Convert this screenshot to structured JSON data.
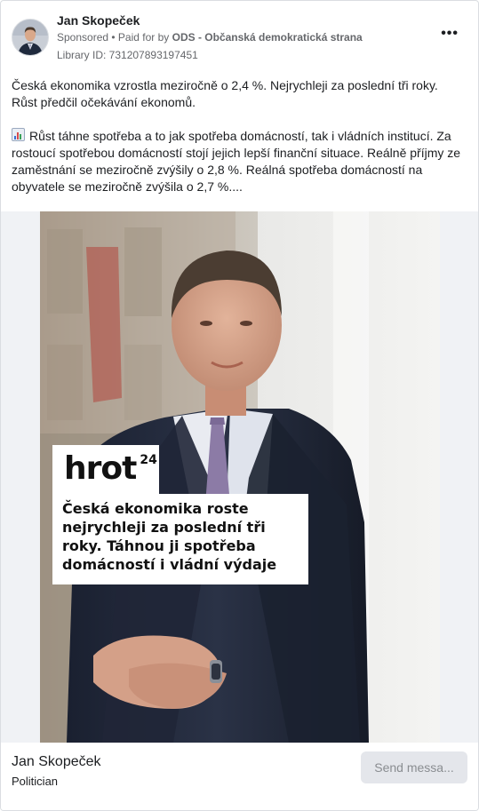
{
  "post": {
    "page_name": "Jan Skopeček",
    "sponsored_label": "Sponsored",
    "paid_for_prefix": " • Paid for by ",
    "paid_for_by": "ODS - Občanská demokratická strana",
    "library_id": "Library ID: 731207893197451",
    "more_icon": "more-horizontal-icon",
    "paragraph_1": "Česká ekonomika vzrostla meziročně o 2,4 %. Nejrychleji za poslední tři roky. Růst předčil očekávání ekonomů.",
    "paragraph_2": "Růst táhne spotřeba a to jak spotřeba domácností, tak i vládních institucí. Za rostoucí spotřebou domácností stojí jejich lepší finanční situace. Reálně příjmy ze zaměstnání se meziročně zvýšily o 2,8 %. Reálná spotřeba domácností na obyvatele se meziročně zvýšila o 2,7 %....",
    "paragraph_2_icon": "bar-chart-emoji-icon"
  },
  "creative": {
    "logo_text": "hrot",
    "logo_superscript": "24",
    "headline": "Česká ekonomika roste nejrychleji za poslední tři roky. Táhnou ji spotřeba domácností i vládní výdaje"
  },
  "footer": {
    "name": "Jan Skopeček",
    "category": "Politician",
    "cta_label": "Send messa..."
  },
  "colors": {
    "text_primary": "#1c1e21",
    "text_secondary": "#65676b",
    "button_bg": "#e4e6eb"
  }
}
